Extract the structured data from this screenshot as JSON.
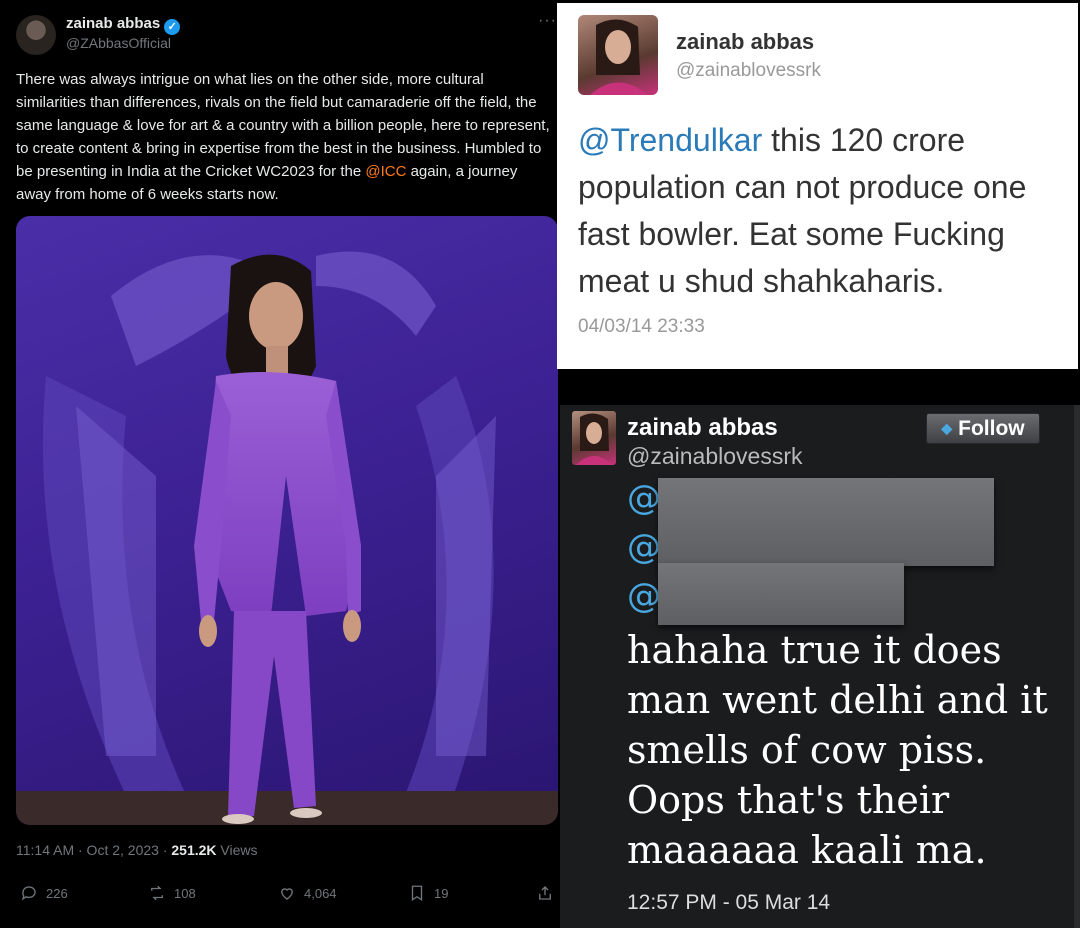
{
  "left_post": {
    "name": "zainab abbas",
    "handle": "@ZAbbasOfficial",
    "more": "···",
    "text_before": "There was always intrigue on what lies on the other side, more cultural similarities than differences, rivals on the field but camaraderie off the field, the same language & love for art & a country with a billion people, here to represent, to create content & bring in expertise from the best in the business. Humbled to be presenting in India at the Cricket WC2023 for the ",
    "mention": "@ICC",
    "text_after": " again, a journey away from home of 6 weeks  starts now.",
    "time": "11:14 AM · Oct 2, 2023 · ",
    "views_count": "251.2K",
    "views_label": " Views",
    "replies": "226",
    "reposts": "108",
    "likes": "4,064",
    "bookmarks": "19"
  },
  "top_right_post": {
    "name": "zainab abbas",
    "handle": "@zainablovessrk",
    "mention": "@Trendulkar",
    "text": " this 120 crore population can not produce one fast bowler. Eat some Fucking meat u shud shahkaharis.",
    "timestamp": "04/03/14 23:33"
  },
  "bottom_right_post": {
    "name": "zainab abbas",
    "handle": "@zainablovessrk",
    "follow_label": "Follow",
    "at_symbol": "@",
    "text": "hahaha true it does man went delhi and it smells of cow piss. Oops that's their maaaaaa kaali ma.",
    "timestamp": "12:57 PM - 05 Mar 14"
  },
  "colors": {
    "x_link": "#ff7a1a",
    "twitter_blue": "#2b7bb9",
    "verified": "#1d9bf0",
    "photo_purple": "#3c2193"
  },
  "icons": [
    "verified-badge-icon",
    "reply-icon",
    "repost-icon",
    "like-icon",
    "bookmark-icon",
    "share-icon",
    "twitter-bird-icon"
  ]
}
